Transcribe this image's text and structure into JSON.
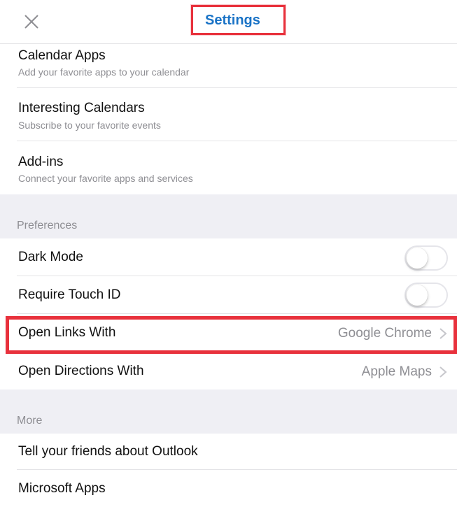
{
  "header": {
    "title": "Settings",
    "close_icon": "close-icon"
  },
  "connected": {
    "items": [
      {
        "title": "Calendar Apps",
        "subtitle": "Add your favorite apps to your calendar"
      },
      {
        "title": "Interesting Calendars",
        "subtitle": "Subscribe to your favorite events"
      },
      {
        "title": "Add-ins",
        "subtitle": "Connect your favorite apps and services"
      }
    ]
  },
  "preferences": {
    "label": "Preferences",
    "dark_mode": {
      "label": "Dark Mode",
      "enabled": false
    },
    "touch_id": {
      "label": "Require Touch ID",
      "enabled": false
    },
    "open_links": {
      "label": "Open Links With",
      "value": "Google Chrome"
    },
    "open_directions": {
      "label": "Open Directions With",
      "value": "Apple Maps"
    }
  },
  "more": {
    "label": "More",
    "items": [
      {
        "title": "Tell your friends about Outlook"
      },
      {
        "title": "Microsoft Apps"
      }
    ]
  },
  "colors": {
    "accent": "#1a73c6",
    "highlight": "#e8313c",
    "section_bg": "#efeff4",
    "secondary_text": "#8e8e93"
  }
}
